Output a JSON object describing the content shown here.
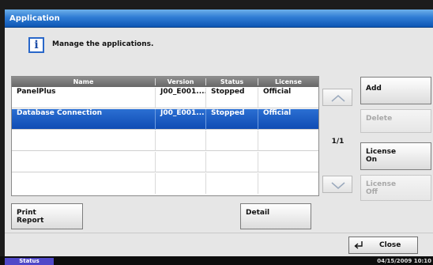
{
  "window": {
    "title": "Application"
  },
  "info": {
    "message": "Manage the applications."
  },
  "table": {
    "headers": [
      "Name",
      "Version",
      "Status",
      "License"
    ],
    "rows": [
      {
        "name": "PanelPlus",
        "version": "J00_E001....",
        "status": "Stopped",
        "license": "Official",
        "selected": false
      },
      {
        "name": "Database Connection",
        "version": "J00_E001...",
        "status": "Stopped",
        "license": "Official",
        "selected": true
      }
    ]
  },
  "pagination": {
    "indicator": "1/1"
  },
  "side_buttons": {
    "add": "Add",
    "delete": "Delete",
    "license_on": [
      "License",
      "On"
    ],
    "license_off": [
      "License",
      "Off"
    ]
  },
  "bottom_buttons": {
    "print_report": [
      "Print",
      "Report"
    ],
    "detail": "Detail",
    "close": "Close"
  },
  "status_bar": {
    "tab": "Status",
    "datetime": "04/15/2009   10:10"
  },
  "colors": {
    "title_bar": "#2f7cd4",
    "selected_row": "#1a5cc4",
    "status_tab": "#5048c8"
  },
  "icons": [
    "info-icon",
    "scroll-up-icon",
    "scroll-down-icon",
    "return-arrow-icon"
  ]
}
